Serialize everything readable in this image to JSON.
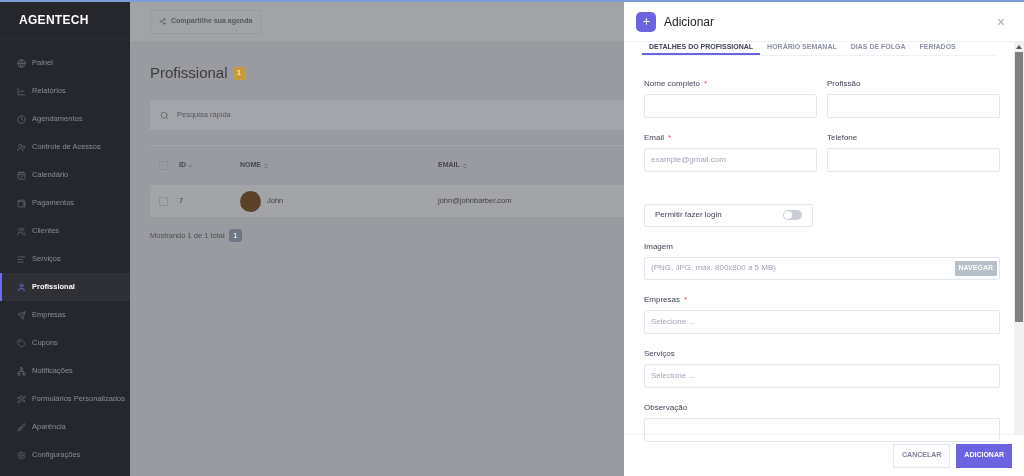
{
  "sidebar": {
    "logo": "AGENTECH",
    "items": [
      {
        "label": "Painel",
        "selected": false
      },
      {
        "label": "Relatórios",
        "selected": false
      },
      {
        "label": "Agendamentos",
        "selected": false
      },
      {
        "label": "Controle de Acessos",
        "selected": false
      },
      {
        "label": "Calendário",
        "selected": false
      },
      {
        "label": "Pagamentos",
        "selected": false
      },
      {
        "label": "Clientes",
        "selected": false
      },
      {
        "label": "Serviços",
        "selected": false
      },
      {
        "label": "Profissional",
        "selected": true
      },
      {
        "label": "Empresas",
        "selected": false
      },
      {
        "label": "Cupons",
        "selected": false
      },
      {
        "label": "Notificações",
        "selected": false
      },
      {
        "label": "Formulários Personalizados",
        "selected": false
      },
      {
        "label": "Aparência",
        "selected": false
      },
      {
        "label": "Configurações",
        "selected": false
      }
    ]
  },
  "toolbar": {
    "share_button": "Compartilhe sua agenda"
  },
  "page": {
    "title": "Profissional",
    "count": "1",
    "search": {
      "placeholder": "Pesquisa rápida"
    },
    "table": {
      "all_checked": false,
      "columns": [
        "ID",
        "NOME",
        "EMAIL"
      ],
      "rows": [
        {
          "checked": false,
          "id": "7",
          "name": "John",
          "email": "john@johnbarber.com"
        }
      ]
    },
    "footer": {
      "text": "Mostrando 1 de 1 total",
      "pages": "1"
    }
  },
  "drawer": {
    "title": "Adicionar",
    "tabs": [
      {
        "label": "DETALHES DO PROFISSIONAL",
        "selected": true
      },
      {
        "label": "HORÁRIO SEMANAL",
        "selected": false
      },
      {
        "label": "DIAS DE FOLGA",
        "selected": false
      },
      {
        "label": "FERIADOS",
        "selected": false
      }
    ],
    "fields": [
      {
        "kind": "text",
        "label": "Nome completo",
        "marker": "*"
      },
      {
        "kind": "text",
        "label": "Profissão"
      },
      {
        "kind": "text",
        "label": "Email",
        "marker": "*",
        "placeholder": "example@gmail.com"
      },
      {
        "kind": "text",
        "label": "Telefone"
      },
      {
        "kind": "toggle",
        "label": "Permitir fazer login",
        "on": false
      },
      {
        "kind": "file",
        "label": "Imagem",
        "placeholder": "(PNG, JPG, máx. 800x800 a 5 MB)",
        "button": "NAVEGAR"
      },
      {
        "kind": "select",
        "label": "Empresas",
        "marker": "*",
        "placeholder": "Selecione ..."
      },
      {
        "kind": "select",
        "label": "Serviços",
        "placeholder": "Selecione ..."
      },
      {
        "kind": "textarea",
        "label": "Observação"
      }
    ],
    "buttons": {
      "cancel": "CANCELAR",
      "submit": "ADICIONAR"
    }
  }
}
